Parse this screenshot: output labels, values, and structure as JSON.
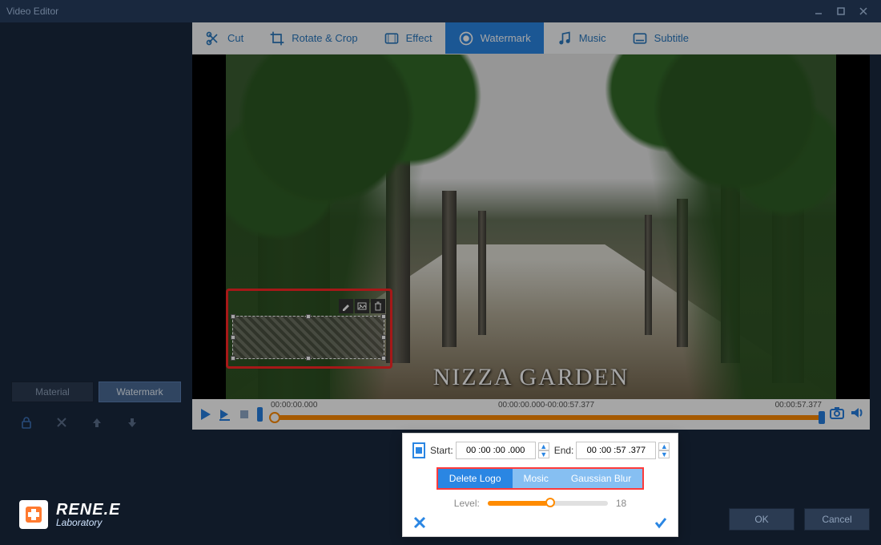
{
  "window": {
    "title": "Video Editor"
  },
  "toolbar": {
    "items": [
      {
        "label": "Cut"
      },
      {
        "label": "Rotate & Crop"
      },
      {
        "label": "Effect"
      },
      {
        "label": "Watermark"
      },
      {
        "label": "Music"
      },
      {
        "label": "Subtitle"
      }
    ],
    "active_index": 3
  },
  "preview": {
    "caption": "NIZZA GARDEN"
  },
  "timeline": {
    "start": "00:00:00.000",
    "range": "00:00:00.000-00:00:57.377",
    "end": "00:00:57.377"
  },
  "sidebar": {
    "material": "Material",
    "watermark": "Watermark"
  },
  "popup": {
    "start_label": "Start:",
    "start_value": "00 :00 :00 .000",
    "end_label": "End:",
    "end_value": "00 :00 :57 .377",
    "modes": [
      "Delete Logo",
      "Mosic",
      "Gaussian Blur"
    ],
    "active_mode": 0,
    "level_label": "Level:",
    "level_value": "18"
  },
  "footer": {
    "ok": "OK",
    "cancel": "Cancel"
  },
  "branding": {
    "line1": "RENE.E",
    "line2": "Laboratory"
  }
}
